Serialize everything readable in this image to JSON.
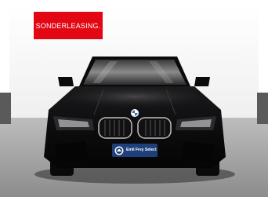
{
  "badge": {
    "label": "SONDERLEASING.",
    "color": "#e30613"
  },
  "plate": {
    "text": "Emil Frey Select",
    "color": "#1f3f7a",
    "logo_icon": "emil-frey-logo-icon"
  },
  "vehicle": {
    "body_color": "#0b0b0c"
  }
}
